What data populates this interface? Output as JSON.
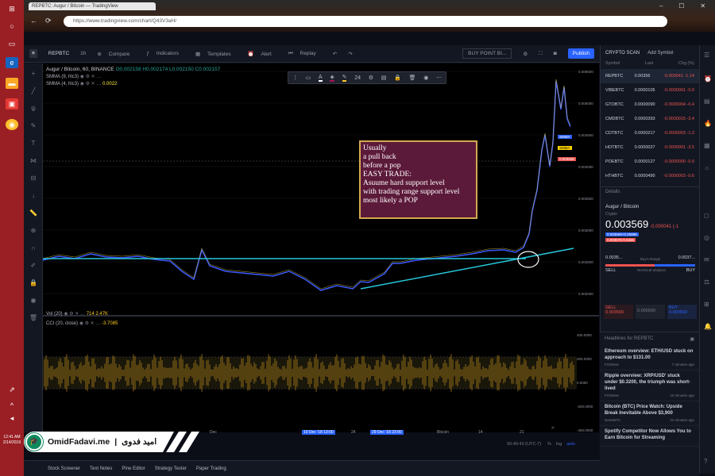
{
  "browser": {
    "tab_title": "REPBTC: Augur / Bitcoin — TradingView",
    "url": "https://www.tradingview.com/chart/Q43V3aH/"
  },
  "toolbar": {
    "symbol": "REPBTC",
    "interval": "1h",
    "compare": "Compare",
    "indicators": "Indicators",
    "templates": "Templates",
    "alert": "Alert",
    "replay": "Replay",
    "layout_name": "BUY POINT BI...",
    "publish": "Publish"
  },
  "legend": {
    "title": "Augur / Bitcoin, 60, BINANCE",
    "ohlc": "O0.002158 H0.002174 L0.002150 C0.002157",
    "smma1": "SMMA (9, hlc3)",
    "smma2": "SMMA (4, hlc3)",
    "smma2_value": "0.0022",
    "vol": "Vol (20)",
    "vol_values": "714  2.47K",
    "cci": "CCI (20, close)",
    "cci_value": "-3.7085"
  },
  "drawbar": {
    "size": "24"
  },
  "annotation": {
    "lines": [
      "Usually",
      "a pull back",
      "before a pop",
      "EASY TRADE:",
      "Asuume hard support level",
      "with trading range support level",
      "most likely a POP"
    ]
  },
  "price_axis": [
    "0.005500",
    "0.005000",
    "0.004500",
    "0.004000",
    "0.003500",
    "0.003000",
    "0.002500",
    "0.002000"
  ],
  "price_tags": [
    "SMMA",
    "SMMA",
    "0.003569"
  ],
  "osc_axis": [
    "400.0000",
    "200.0000",
    "0.0000",
    "-200.0000",
    "-400.0000"
  ],
  "time_axis": [
    "Dec",
    "10 Dec '18  13:00",
    "24",
    "29 Dec '18  23:00",
    "Bitcoin",
    "14",
    "21"
  ],
  "watchlist": {
    "tab": "CRYPTO SCAN",
    "add": "Add Symbol",
    "headers": [
      "Symbol",
      "Last",
      "Chg (%)"
    ],
    "rows": [
      {
        "symbol": "REPBTC",
        "last": "0.00356",
        "chg": "-0.000041 -1.14"
      },
      {
        "symbol": "VIBEBTC",
        "last": "0.0000105",
        "chg": "-0.0000001 -0.9"
      },
      {
        "symbol": "GTOBTC",
        "last": "0.0000090",
        "chg": "-0.0000004 -0.4"
      },
      {
        "symbol": "CMDBTC",
        "last": "0.0000393",
        "chg": "-0.0000015 -3.4"
      },
      {
        "symbol": "CDTBTC",
        "last": "0.0000217",
        "chg": "-0.0000003 -1.3"
      },
      {
        "symbol": "HOTBTC",
        "last": "0.0000027",
        "chg": "-0.0000001 -3.5"
      },
      {
        "symbol": "POEBTC",
        "last": "0.0000127",
        "chg": "-0.0000000 -0.0"
      },
      {
        "symbol": "HTHBTC",
        "last": "0.0000490",
        "chg": "-0.0000003 -0.6"
      }
    ]
  },
  "details": {
    "header": "Details",
    "name": "Augur / Bitcoin",
    "type": "Crypto",
    "price": "0.003569",
    "change": "-0.000041 (-1",
    "bid": "0.003569+0.25999",
    "ask": "0.003576-0.6466",
    "range_low": "0.0035...",
    "range_label": "Day's Range",
    "range_high": "0.0037...",
    "sell": "SELL",
    "buy": "BUY",
    "tech": "Technical analysis",
    "sell_box": "0.003569",
    "mid_box": "0.000000",
    "buy_box": "0.003569"
  },
  "news": {
    "header": "Headlines for REPBTC",
    "items": [
      {
        "title": "Ethereum overview: ETH/USD stuck on approach to $131.00",
        "source": "FXStreet",
        "time": "7 minutes ago"
      },
      {
        "title": "Ripple overview: XRP/USD' stuck under $0.3200, the triumph was short-lived",
        "source": "FXStreet",
        "time": "10 minutes ago"
      },
      {
        "title": "Bitcoin (BTC) Price Watch: Upside Break Inevitable Above $3,900",
        "source": "NewsBTC",
        "time": "21 minutes ago"
      },
      {
        "title": "Spotify Competitor Now Allows You to Earn Bitcoin for Streaming",
        "source": "",
        "time": ""
      }
    ]
  },
  "bottom": {
    "time": "00:40:43 (UTC-7)",
    "log": "log",
    "auto": "auto",
    "tabs": [
      "Stock Screener",
      "Text Notes",
      "Pine Editor",
      "Strategy Tester",
      "Paper Trading"
    ]
  },
  "watermark": {
    "site": "OmidFadavi.me",
    "sep": "|",
    "name": "امید فدوی"
  },
  "clock": {
    "time": "12:41 AM",
    "date": "2/14/2019"
  },
  "colors": {
    "price_line": "#3d5afe",
    "price_highlight": "#ffeb3b",
    "trendline": "#26c6da",
    "volume": "#c8951e",
    "annotation_bg": "#5c1a3a",
    "annotation_border": "#d4a84e",
    "accent": "#2962ff"
  }
}
